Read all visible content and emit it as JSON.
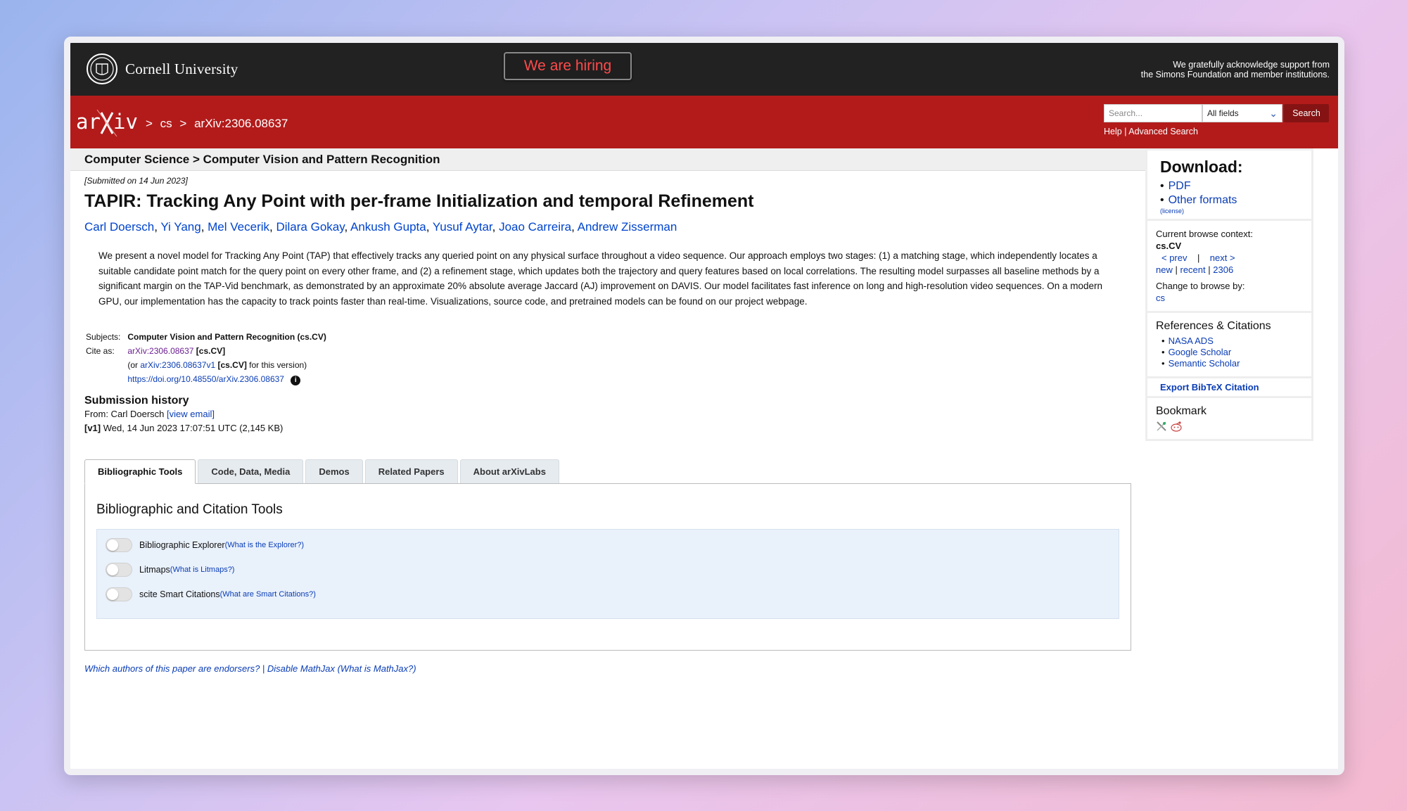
{
  "header": {
    "institution": "Cornell University",
    "hiring_label": "We are hiring",
    "support_line1": "We gratefully acknowledge support from",
    "support_line2": "the Simons Foundation and member institutions."
  },
  "navbar": {
    "crumb_sep1": ">",
    "crumb_cs": "cs",
    "crumb_sep2": ">",
    "crumb_id": "arXiv:2306.08637",
    "search_placeholder": "Search...",
    "field_selected": "All fields",
    "search_button": "Search",
    "help": "Help",
    "help_sep": "|",
    "advanced": "Advanced Search"
  },
  "paper": {
    "breadcrumb": "Computer Science > Computer Vision and Pattern Recognition",
    "submitted": "[Submitted on 14 Jun 2023]",
    "title": "TAPIR: Tracking Any Point with per-frame Initialization and temporal Refinement",
    "authors": [
      "Carl Doersch",
      "Yi Yang",
      "Mel Vecerik",
      "Dilara Gokay",
      "Ankush Gupta",
      "Yusuf Aytar",
      "Joao Carreira",
      "Andrew Zisserman"
    ],
    "abstract": "We present a novel model for Tracking Any Point (TAP) that effectively tracks any queried point on any physical surface throughout a video sequence. Our approach employs two stages: (1) a matching stage, which independently locates a suitable candidate point match for the query point on every other frame, and (2) a refinement stage, which updates both the trajectory and query features based on local correlations. The resulting model surpasses all baseline methods by a significant margin on the TAP-Vid benchmark, as demonstrated by an approximate 20% absolute average Jaccard (AJ) improvement on DAVIS. Our model facilitates fast inference on long and high-resolution video sequences. On a modern GPU, our implementation has the capacity to track points faster than real-time. Visualizations, source code, and pretrained models can be found on our project webpage.",
    "subjects_label": "Subjects:",
    "subjects_value": "Computer Vision and Pattern Recognition (cs.CV)",
    "cite_label": "Cite as:",
    "cite_id": "arXiv:2306.08637",
    "cite_cat": "[cs.CV]",
    "cite_or_prefix": "(or",
    "cite_version": "arXiv:2306.08637v1",
    "cite_version_cat": "[cs.CV]",
    "cite_version_suffix": "for this version)",
    "doi": "https://doi.org/10.48550/arXiv.2306.08637",
    "info_icon": "i"
  },
  "history": {
    "title": "Submission history",
    "from_prefix": "From: Carl Doersch",
    "view_email": "[view email]",
    "v1_label": "[v1]",
    "v1_text": "Wed, 14 Jun 2023 17:07:51 UTC (2,145 KB)"
  },
  "tabs": [
    "Bibliographic Tools",
    "Code, Data, Media",
    "Demos",
    "Related Papers",
    "About arXivLabs"
  ],
  "tools": {
    "heading": "Bibliographic and Citation Tools",
    "items": [
      {
        "label": "Bibliographic Explorer",
        "link": "(What is the Explorer?)"
      },
      {
        "label": "Litmaps",
        "link": "(What is Litmaps?)"
      },
      {
        "label": "scite Smart Citations",
        "link": "(What are Smart Citations?)"
      }
    ]
  },
  "footer": {
    "links": "Which authors of this paper are endorsers? | Disable MathJax (What is MathJax?)"
  },
  "sidebar": {
    "download_title": "Download:",
    "pdf": "PDF",
    "other_formats": "Other formats",
    "license": "(license)",
    "context_label": "Current browse context:",
    "context_value": "cs.CV",
    "prev": "< prev",
    "sep": "|",
    "next": "next >",
    "new": "new",
    "recent": "recent",
    "year": "2306",
    "change_label": "Change to browse by:",
    "change_cs": "cs",
    "refs_title": "References & Citations",
    "refs": [
      "NASA ADS",
      "Google Scholar",
      "Semantic Scholar"
    ],
    "bibtex": "Export BibTeX Citation",
    "bookmark_title": "Bookmark"
  },
  "colors": {
    "arxiv_red": "#b31b1b",
    "dark_bar": "#222222",
    "link_blue": "#0a3db5"
  }
}
